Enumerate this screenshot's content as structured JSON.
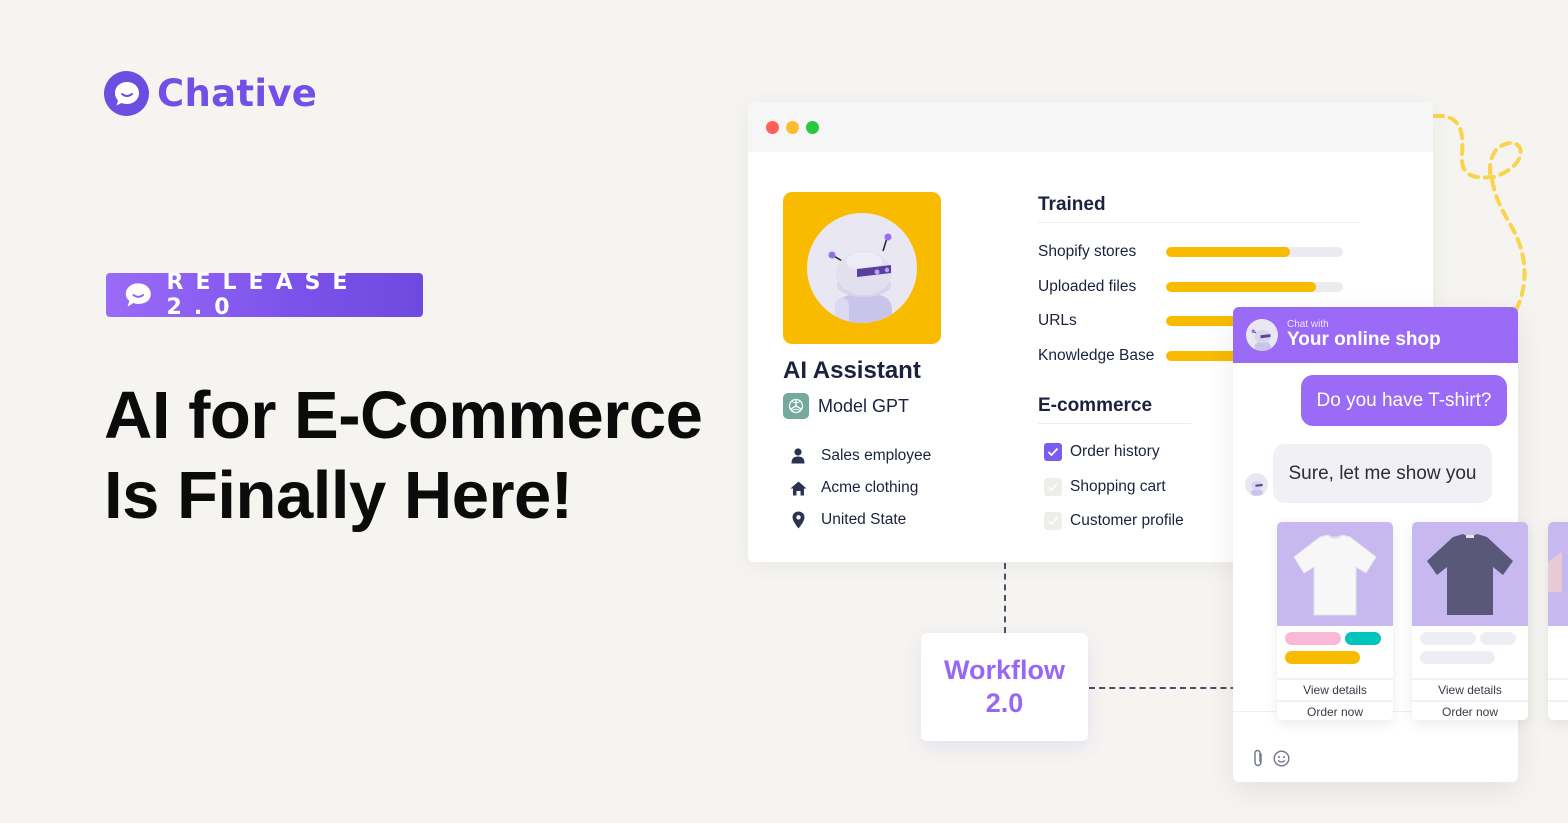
{
  "brand": {
    "name": "Chative",
    "accent": "#7350e5",
    "logo_icon": "chat-bubble-smile-icon"
  },
  "release_badge": {
    "label": "RELEASE 2.0",
    "icon": "chat-bubble-smile-icon"
  },
  "headline": {
    "line1": "AI for E-Commerce",
    "line2": "Is Finally Here!"
  },
  "window": {
    "controls": [
      "close",
      "minimize",
      "maximize"
    ],
    "assistant": {
      "name": "AI Assistant",
      "model": "Model GPT",
      "model_icon": "openai-icon",
      "avatar": "robot-avatar",
      "details": [
        {
          "icon": "user-icon",
          "text": "Sales employee"
        },
        {
          "icon": "home-icon",
          "text": "Acme clothing"
        },
        {
          "icon": "location-pin-icon",
          "text": "United State"
        }
      ]
    },
    "trained": {
      "title": "Trained",
      "items": [
        {
          "label": "Shopify stores",
          "progress": 0.7
        },
        {
          "label": "Uploaded files",
          "progress": 0.85
        },
        {
          "label": "URLs",
          "progress": 0.75
        },
        {
          "label": "Knowledge Base",
          "progress": 0.75
        }
      ]
    },
    "ecommerce": {
      "title": "E-commerce",
      "items": [
        {
          "label": "Order history",
          "checked": true
        },
        {
          "label": "Shopping cart",
          "checked": false
        },
        {
          "label": "Customer profile",
          "checked": false
        }
      ]
    }
  },
  "workflow": {
    "line1": "Workflow",
    "line2": "2.0"
  },
  "chat": {
    "header_sub": "Chat with",
    "header_title": "Your online shop",
    "messages": [
      {
        "from": "user",
        "text": "Do you have T-shirt?"
      },
      {
        "from": "bot",
        "text": "Sure, let me show you"
      }
    ],
    "products": [
      {
        "image": "white-tshirt",
        "color": "#ffffff",
        "tags": [
          "#f9b8d6",
          "#00c5bd",
          "#f8bb00"
        ],
        "view_label": "View details",
        "order_label": "Order now"
      },
      {
        "image": "navy-tshirt",
        "color": "#5a5878",
        "tags": [
          "#eceef3",
          "#eceef3",
          "#eceef3"
        ],
        "view_label": "View details",
        "order_label": "Order now"
      },
      {
        "image": "partial-product",
        "color": "#e8c9d6",
        "tags": [],
        "view_label": "",
        "order_label": ""
      }
    ],
    "tools": [
      "attachment-icon",
      "emoji-icon"
    ]
  },
  "colors": {
    "background": "#f5f4f1",
    "purple": "#9b6af7",
    "yellow": "#f8bb00",
    "text_dark": "#1a2240"
  }
}
